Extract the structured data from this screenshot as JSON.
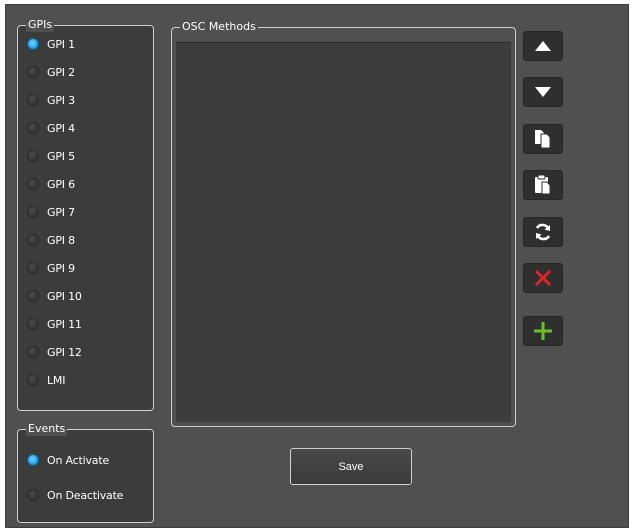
{
  "gpis": {
    "legend": "GPIs",
    "items": [
      {
        "label": "GPI 1",
        "selected": true
      },
      {
        "label": "GPI 2",
        "selected": false
      },
      {
        "label": "GPI 3",
        "selected": false
      },
      {
        "label": "GPI 4",
        "selected": false
      },
      {
        "label": "GPI 5",
        "selected": false
      },
      {
        "label": "GPI 6",
        "selected": false
      },
      {
        "label": "GPI 7",
        "selected": false
      },
      {
        "label": "GPI 8",
        "selected": false
      },
      {
        "label": "GPI 9",
        "selected": false
      },
      {
        "label": "GPI 10",
        "selected": false
      },
      {
        "label": "GPI 11",
        "selected": false
      },
      {
        "label": "GPI 12",
        "selected": false
      },
      {
        "label": "LMI",
        "selected": false
      }
    ]
  },
  "events": {
    "legend": "Events",
    "items": [
      {
        "label": "On Activate",
        "selected": true
      },
      {
        "label": "On Deactivate",
        "selected": false
      }
    ]
  },
  "osc": {
    "legend": "OSC Methods",
    "items": []
  },
  "save_label": "Save",
  "toolbar": [
    {
      "icon": "move-up-icon",
      "name": "move-up-button"
    },
    {
      "icon": "move-down-icon",
      "name": "move-down-button"
    },
    {
      "icon": "copy-icon",
      "name": "copy-button"
    },
    {
      "icon": "paste-icon",
      "name": "paste-button"
    },
    {
      "icon": "refresh-icon",
      "name": "refresh-button"
    },
    {
      "icon": "delete-icon",
      "name": "delete-button"
    },
    {
      "icon": "add-icon",
      "name": "add-button"
    }
  ],
  "colors": {
    "panel_bg": "#505050",
    "group_bg": "#3c3c3c",
    "radio_selected": "#29a8ec",
    "delete_red": "#e0242a",
    "add_green": "#6abf2e"
  }
}
